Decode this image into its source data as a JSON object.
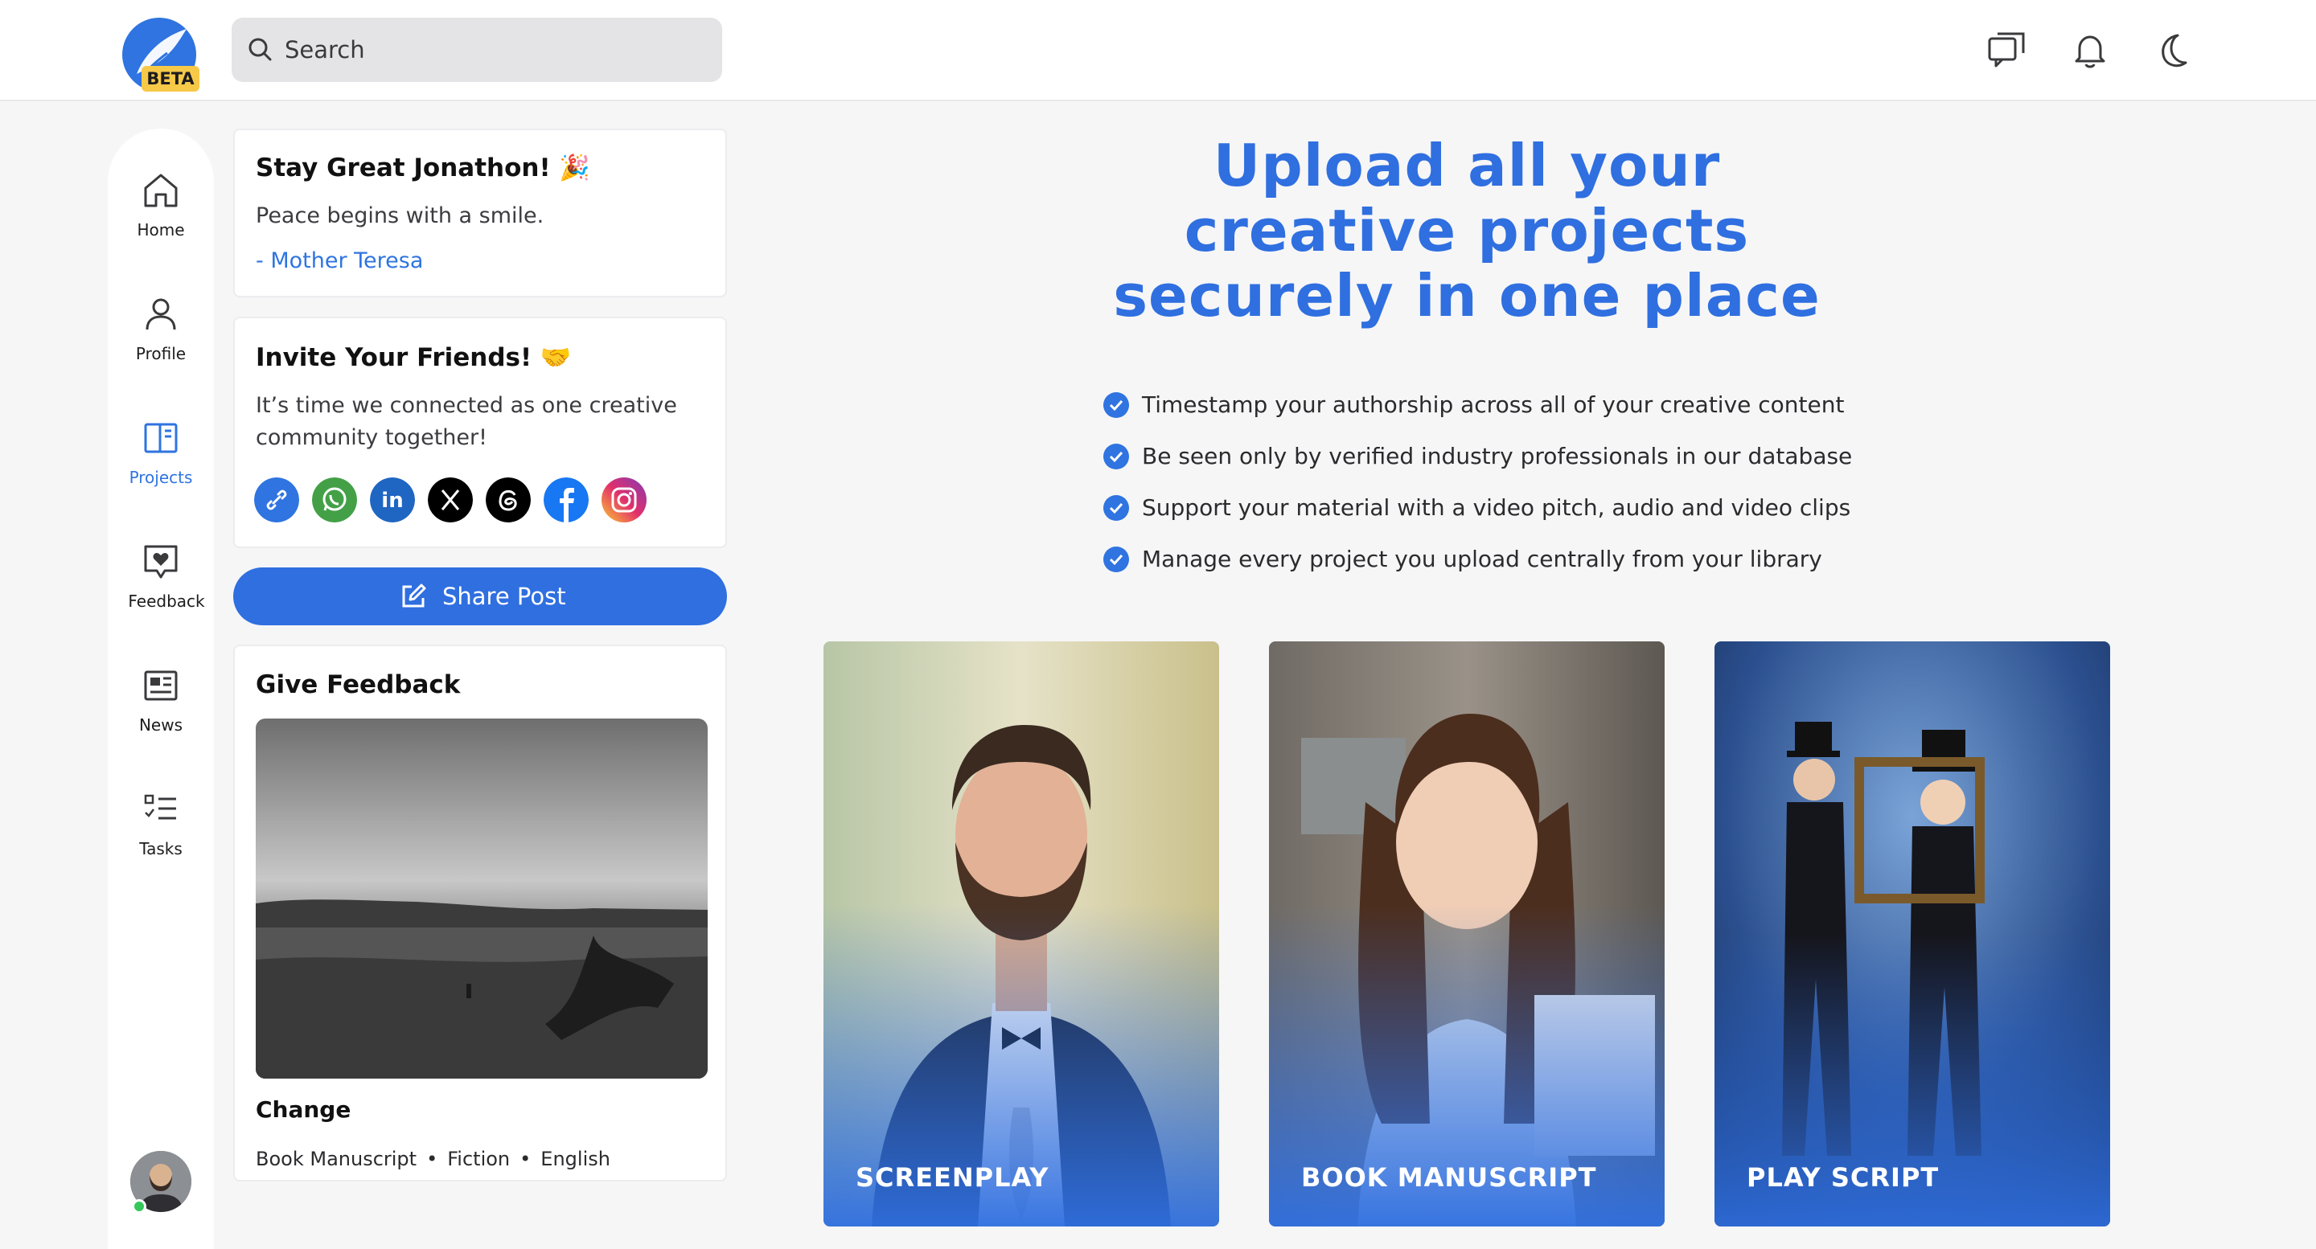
{
  "header": {
    "logo_badge": "BETA",
    "search_placeholder": "Search",
    "icons": [
      "messages-icon",
      "bell-icon",
      "moon-icon"
    ]
  },
  "sidenav": {
    "items": [
      {
        "label": "Home",
        "icon": "home-icon",
        "active": false
      },
      {
        "label": "Profile",
        "icon": "user-icon",
        "active": false
      },
      {
        "label": "Projects",
        "icon": "projects-icon",
        "active": true
      },
      {
        "label": "Feedback",
        "icon": "feedback-heart-icon",
        "active": false
      },
      {
        "label": "News",
        "icon": "news-icon",
        "active": false
      },
      {
        "label": "Tasks",
        "icon": "tasks-icon",
        "active": false
      }
    ]
  },
  "greeting": {
    "title": "Stay Great Jonathon! 🎉",
    "quote": "Peace begins with a smile.",
    "author": "- Mother Teresa"
  },
  "invite": {
    "title": "Invite Your Friends! 🤝",
    "line1": "It’s time we connected as one creative",
    "line2": "community together!",
    "socials": [
      "link-icon",
      "whatsapp-icon",
      "linkedin-icon",
      "x-icon",
      "threads-icon",
      "facebook-icon",
      "instagram-icon"
    ]
  },
  "share_button": {
    "label": "Share Post"
  },
  "feedback": {
    "title": "Give Feedback",
    "item_title": "Change",
    "meta": [
      "Book Manuscript",
      "Fiction",
      "English"
    ]
  },
  "hero": {
    "line1": "Upload all your",
    "line2": "creative projects",
    "line3": "securely in one place",
    "features": [
      "Timestamp your authorship across all of your creative content",
      "Be seen only by verified industry professionals in our database",
      "Support your material with a video pitch, audio and video clips",
      "Manage every project you upload centrally from your library"
    ]
  },
  "tiles": [
    {
      "label": "SCREENPLAY"
    },
    {
      "label": "BOOK MANUSCRIPT"
    },
    {
      "label": "PLAY SCRIPT"
    }
  ],
  "colors": {
    "accent": "#2f74e0",
    "badge": "#f7c948",
    "online": "#34c759"
  }
}
